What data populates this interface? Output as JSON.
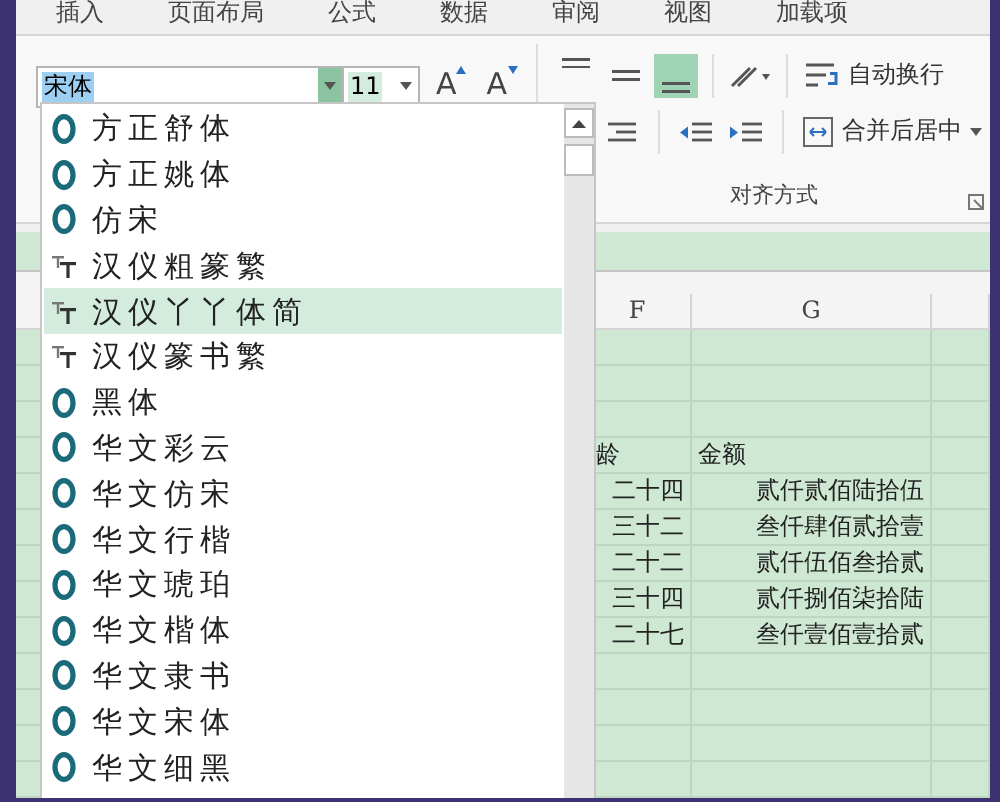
{
  "ribbon_tabs": [
    {
      "label": "插入"
    },
    {
      "label": "页面布局"
    },
    {
      "label": "公式"
    },
    {
      "label": "数据"
    },
    {
      "label": "审阅"
    },
    {
      "label": "视图"
    },
    {
      "label": "加载项"
    }
  ],
  "font_box": {
    "value": "宋体"
  },
  "size_box": {
    "value": "11"
  },
  "grow_font": {
    "label": "A"
  },
  "shrink_font": {
    "label": "A"
  },
  "align_buttons": [
    {
      "kind": "top",
      "selected": false
    },
    {
      "kind": "middle",
      "selected": false
    },
    {
      "kind": "bottom",
      "selected": true
    }
  ],
  "wrap_button": {
    "label": "自动换行"
  },
  "merge_button": {
    "label": "合并后居中"
  },
  "group_label": "对齐方式",
  "font_list": [
    {
      "name": "方正舒体",
      "kind": "opentype",
      "selected": false
    },
    {
      "name": "方正姚体",
      "kind": "opentype",
      "selected": false
    },
    {
      "name": "仿宋",
      "kind": "opentype",
      "selected": false
    },
    {
      "name": "汉仪粗篆繁",
      "kind": "truetype",
      "selected": false
    },
    {
      "name": "汉仪丫丫体简",
      "kind": "truetype",
      "selected": true
    },
    {
      "name": "汉仪篆书繁",
      "kind": "truetype",
      "selected": false
    },
    {
      "name": "黑体",
      "kind": "opentype",
      "selected": false
    },
    {
      "name": "华文彩云",
      "kind": "opentype",
      "selected": false
    },
    {
      "name": "华文仿宋",
      "kind": "opentype",
      "selected": false
    },
    {
      "name": "华文行楷",
      "kind": "opentype",
      "selected": false
    },
    {
      "name": "华文琥珀",
      "kind": "opentype",
      "selected": false
    },
    {
      "name": "华文楷体",
      "kind": "opentype",
      "selected": false
    },
    {
      "name": "华文隶书",
      "kind": "opentype",
      "selected": false
    },
    {
      "name": "华文宋体",
      "kind": "opentype",
      "selected": false
    },
    {
      "name": "华文细黑",
      "kind": "opentype",
      "selected": false
    }
  ],
  "sheet": {
    "columns": [
      "F",
      "G"
    ],
    "rows": [
      {
        "f": "龄",
        "g": "金额",
        "kind": "header"
      },
      {
        "f": "二十四",
        "g": "贰仟贰佰陆拾伍",
        "kind": "data"
      },
      {
        "f": "三十二",
        "g": "叁仟肆佰贰拾壹",
        "kind": "data"
      },
      {
        "f": "二十二",
        "g": "贰仟伍佰叁拾贰",
        "kind": "data"
      },
      {
        "f": "三十四",
        "g": "贰仟捌佰柒拾陆",
        "kind": "data"
      },
      {
        "f": "二十七",
        "g": "叁仟壹佰壹拾贰",
        "kind": "data"
      }
    ]
  }
}
